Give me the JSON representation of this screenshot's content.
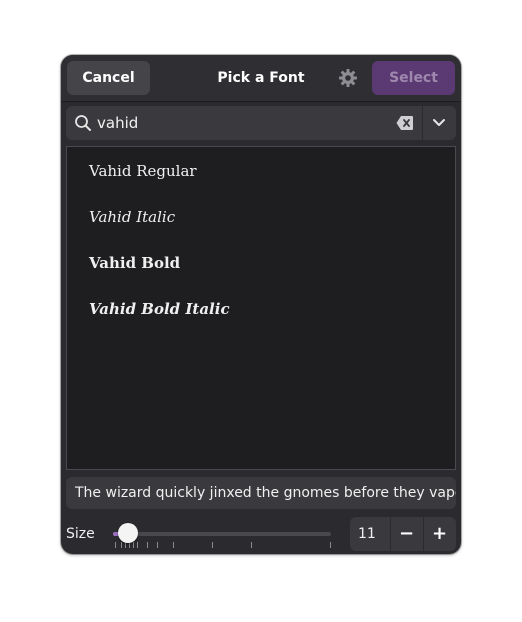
{
  "header": {
    "cancel_label": "Cancel",
    "title": "Pick a Font",
    "select_label": "Select",
    "settings_icon": "gear-icon"
  },
  "search": {
    "value": "vahid",
    "icons": [
      "search-icon",
      "clear-icon",
      "chevron-down-icon"
    ]
  },
  "font_list": {
    "items": [
      {
        "label": "Vahid Regular",
        "style": "regular"
      },
      {
        "label": "Vahid Italic",
        "style": "italic"
      },
      {
        "label": "Vahid Bold",
        "style": "bold"
      },
      {
        "label": "Vahid Bold Italic",
        "style": "bold-italic"
      }
    ]
  },
  "preview": {
    "text": "The wizard quickly jinxed the gnomes before they vaporized."
  },
  "size": {
    "label": "Size",
    "value": "11",
    "slider_fraction": 0.07,
    "minus_label": "−",
    "plus_label": "+"
  },
  "colors": {
    "accent": "#9c6fc2",
    "select_button": "#5b3a73",
    "dialog_bg": "#2b2a2e",
    "list_bg": "#1e1e21"
  }
}
